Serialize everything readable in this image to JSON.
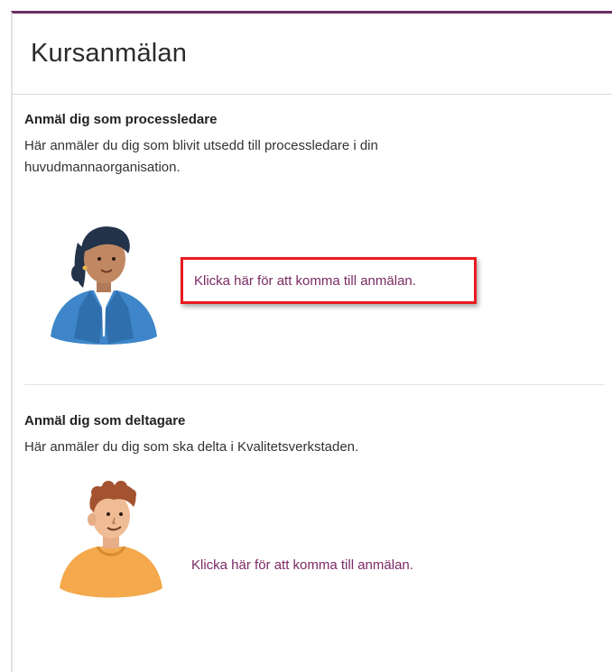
{
  "page": {
    "title": "Kursanmälan"
  },
  "sections": [
    {
      "heading": "Anmäl dig som processledare",
      "description": "Här anmäler du dig som blivit utsedd till processledare i din huvudmannaorganisation.",
      "link_label": "Klicka här för att komma till anmälan."
    },
    {
      "heading": "Anmäl dig som deltagare",
      "description": "Här anmäler du dig som ska delta i Kvalitetsverkstaden.",
      "link_label": "Klicka här för att komma till anmälan."
    }
  ],
  "colors": {
    "accent": "#6b2d63",
    "link": "#7a2a64",
    "highlight_box": "#ea1b22"
  },
  "icons": [
    "processledare-avatar-icon",
    "deltagare-avatar-icon"
  ]
}
